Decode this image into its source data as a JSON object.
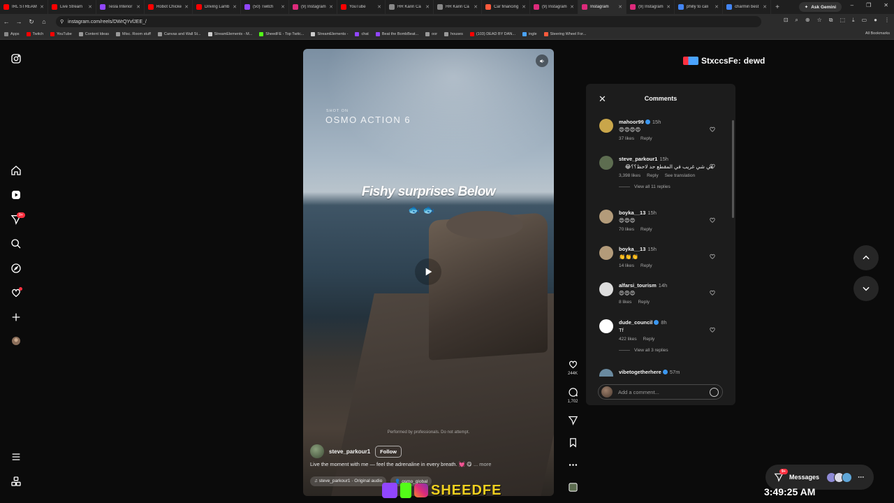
{
  "browser": {
    "tabs": [
      {
        "label": "IRL STREAM",
        "color": "#ff0000"
      },
      {
        "label": "Live Stream",
        "color": "#ff0000"
      },
      {
        "label": "Tesla Interior",
        "color": "#9146ff"
      },
      {
        "label": "Robot Chicken",
        "color": "#ff0000"
      },
      {
        "label": "Driving Lamb",
        "color": "#ff0000"
      },
      {
        "label": "(50) Twitch",
        "color": "#9146ff"
      },
      {
        "label": "(9) Instagram",
        "color": "#dd2a7b"
      },
      {
        "label": "YouTube",
        "color": "#ff0000"
      },
      {
        "label": "HR Karin Ca",
        "color": "#888888"
      },
      {
        "label": "HR Karin Ca",
        "color": "#888888"
      },
      {
        "label": "Car financing",
        "color": "#ff5a3c"
      },
      {
        "label": "(9) Instagram",
        "color": "#dd2a7b"
      },
      {
        "label": "Instagram",
        "color": "#dd2a7b",
        "active": true
      },
      {
        "label": "(9) Instagram",
        "color": "#dd2a7b"
      },
      {
        "label": "philly to cali",
        "color": "#4285f4"
      },
      {
        "label": "charmin best",
        "color": "#4285f4"
      }
    ],
    "new_tab": "+",
    "ask_gemini": "Ask Gemini",
    "url": "instagram.com/reels/DWrQYvfJEE_/",
    "bookmarks": [
      {
        "label": "Apps",
        "color": "#888888"
      },
      {
        "label": "Twitch",
        "color": "#ff0000"
      },
      {
        "label": "YouTube",
        "color": "#ff0000"
      },
      {
        "label": "Content Ideas",
        "color": "#999999"
      },
      {
        "label": "Misc. Room stuff",
        "color": "#999999"
      },
      {
        "label": "Canvas and Wall St...",
        "color": "#999999"
      },
      {
        "label": "StreamElements - M...",
        "color": "#cccccc"
      },
      {
        "label": "SheedFE - Top Twitc...",
        "color": "#53fc18"
      },
      {
        "label": "StreamElements -",
        "color": "#cccccc"
      },
      {
        "label": "chat",
        "color": "#9146ff"
      },
      {
        "label": "Beat the BombBeat...",
        "color": "#9146ff"
      },
      {
        "label": "oor",
        "color": "#999999"
      },
      {
        "label": "houses",
        "color": "#999999"
      },
      {
        "label": "(103) DEAD BY DAN...",
        "color": "#ff0000"
      },
      {
        "label": "ingle",
        "color": "#4aa3ff"
      },
      {
        "label": "Steering Wheel For...",
        "color": "#ff5a3c"
      }
    ],
    "all_bookmarks": "All Bookmarks"
  },
  "rail": {
    "reels_badge": "9+"
  },
  "reel": {
    "shot_on": "SHOT ON",
    "camera": "OSMO ACTION 6",
    "overlay_title": "Fishy surprises Below",
    "fish_emoji": "🐟 🐟",
    "disclaimer": "Performed by professionals. Do not attempt.",
    "author": "steve_parkour1",
    "follow_label": "Follow",
    "caption": "Live the moment with me — feel the adrenaline in every breath. 💓 😋",
    "more_label": "... more",
    "audio": "steve_parkour1 · Original audio",
    "collab": "osmo_global",
    "likes": "244K",
    "comments_count": "1,702"
  },
  "watermark": {
    "brand": "SHEEDFE"
  },
  "streamer_overlay": {
    "name": "StxccsFe:",
    "message": "dewd"
  },
  "comments_panel": {
    "title": "Comments",
    "input_placeholder": "Add a comment...",
    "items": [
      {
        "user": "mahoor99",
        "verified": true,
        "time": "15h",
        "text": "😍😍😍😍",
        "likes": "37 likes",
        "reply": "Reply",
        "avatar": "#c9a64a"
      },
      {
        "user": "steve_parkour1",
        "verified": false,
        "time": "15h",
        "text": "في شي غريب في المقطع حد لاحظ؟؟😂",
        "rtl": true,
        "likes": "3,398 likes",
        "reply": "Reply",
        "translate": "See translation",
        "replies": "View all 11 replies",
        "avatar": "#5d6d50"
      },
      {
        "user": "boyka__13",
        "verified": false,
        "time": "15h",
        "text": "😍😍😍",
        "likes": "70 likes",
        "reply": "Reply",
        "avatar": "#b39b7a"
      },
      {
        "user": "boyka__13",
        "verified": false,
        "time": "15h",
        "text": "👏👏👏",
        "likes": "14 likes",
        "reply": "Reply",
        "avatar": "#b39b7a"
      },
      {
        "user": "alfarsi_tourism",
        "verified": false,
        "time": "14h",
        "text": "😍😍😍",
        "likes": "8 likes",
        "reply": "Reply",
        "avatar": "#dddddd"
      },
      {
        "user": "dude_council",
        "verified": true,
        "time": "8h",
        "text": "Tf",
        "likes": "422 likes",
        "reply": "Reply",
        "replies": "View all 3 replies",
        "avatar": "#ffffff"
      },
      {
        "user": "vibetogetherhere",
        "verified": true,
        "time": "57m",
        "text": "",
        "likes": "",
        "reply": "",
        "avatar": "#6a8aa0"
      }
    ]
  },
  "messages": {
    "label": "Messages",
    "badge": "9+"
  },
  "clock": "3:49:25 AM"
}
